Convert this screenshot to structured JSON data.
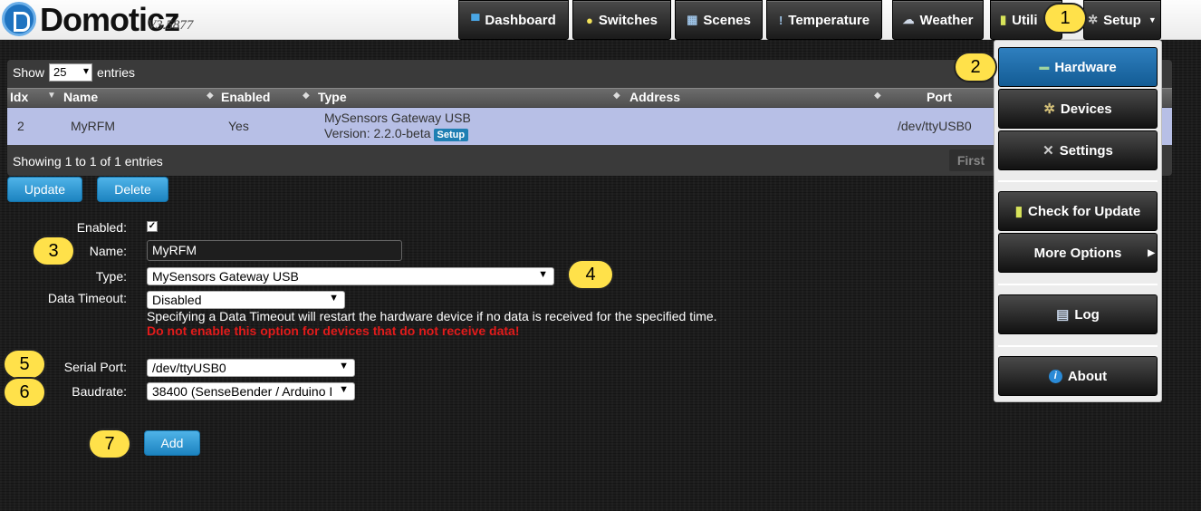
{
  "header": {
    "brand": "Domoticz",
    "version": "V3.5877",
    "nav": [
      {
        "label": "Dashboard",
        "icon": "monitor-icon"
      },
      {
        "label": "Switches",
        "icon": "lightbulb-icon"
      },
      {
        "label": "Scenes",
        "icon": "clapper-icon"
      },
      {
        "label": "Temperature",
        "icon": "thermometer-icon"
      },
      {
        "label": "Weather",
        "icon": "cloud-icon"
      },
      {
        "label": "Utili",
        "icon": "battery-icon"
      },
      {
        "label": "Setup",
        "icon": "gear-icon"
      }
    ]
  },
  "table": {
    "show_label": "Show",
    "page_size": "25",
    "entries_label": "entries",
    "columns": [
      "Idx",
      "Name",
      "Enabled",
      "Type",
      "Address",
      "Port"
    ],
    "rows": [
      {
        "idx": "2",
        "name": "MyRFM",
        "enabled": "Yes",
        "type_line1": "MySensors Gateway USB",
        "type_line2": "Version: 2.2.0-beta",
        "setup_badge": "Setup",
        "address": "",
        "port": "/dev/ttyUSB0"
      }
    ],
    "info": "Showing 1 to 1 of 1 entries",
    "first_label": "First"
  },
  "actions": {
    "update": "Update",
    "delete": "Delete",
    "add": "Add"
  },
  "form": {
    "enabled_label": "Enabled:",
    "name_label": "Name:",
    "name_value": "MyRFM",
    "type_label": "Type:",
    "type_value": "MySensors Gateway USB",
    "timeout_label": "Data Timeout:",
    "timeout_value": "Disabled",
    "timeout_info": "Specifying a Data Timeout will restart the hardware device if no data is received for the specified time.",
    "timeout_warning": "Do not enable this option for devices that do not receive data!",
    "serial_label": "Serial Port:",
    "serial_value": "/dev/ttyUSB0",
    "baud_label": "Baudrate:",
    "baud_value": "38400 (SenseBender / Arduino I"
  },
  "menu": {
    "items": [
      {
        "label": "Hardware",
        "icon": "hardware-icon"
      },
      {
        "label": "Devices",
        "icon": "gear-icon"
      },
      {
        "label": "Settings",
        "icon": "tools-icon"
      },
      {
        "label": "Check for Update",
        "icon": "update-icon"
      },
      {
        "label": "More Options",
        "icon": ""
      },
      {
        "label": "Log",
        "icon": "log-icon"
      },
      {
        "label": "About",
        "icon": "info-icon"
      }
    ]
  },
  "callouts": [
    "1",
    "2",
    "3",
    "4",
    "5",
    "6",
    "7"
  ]
}
